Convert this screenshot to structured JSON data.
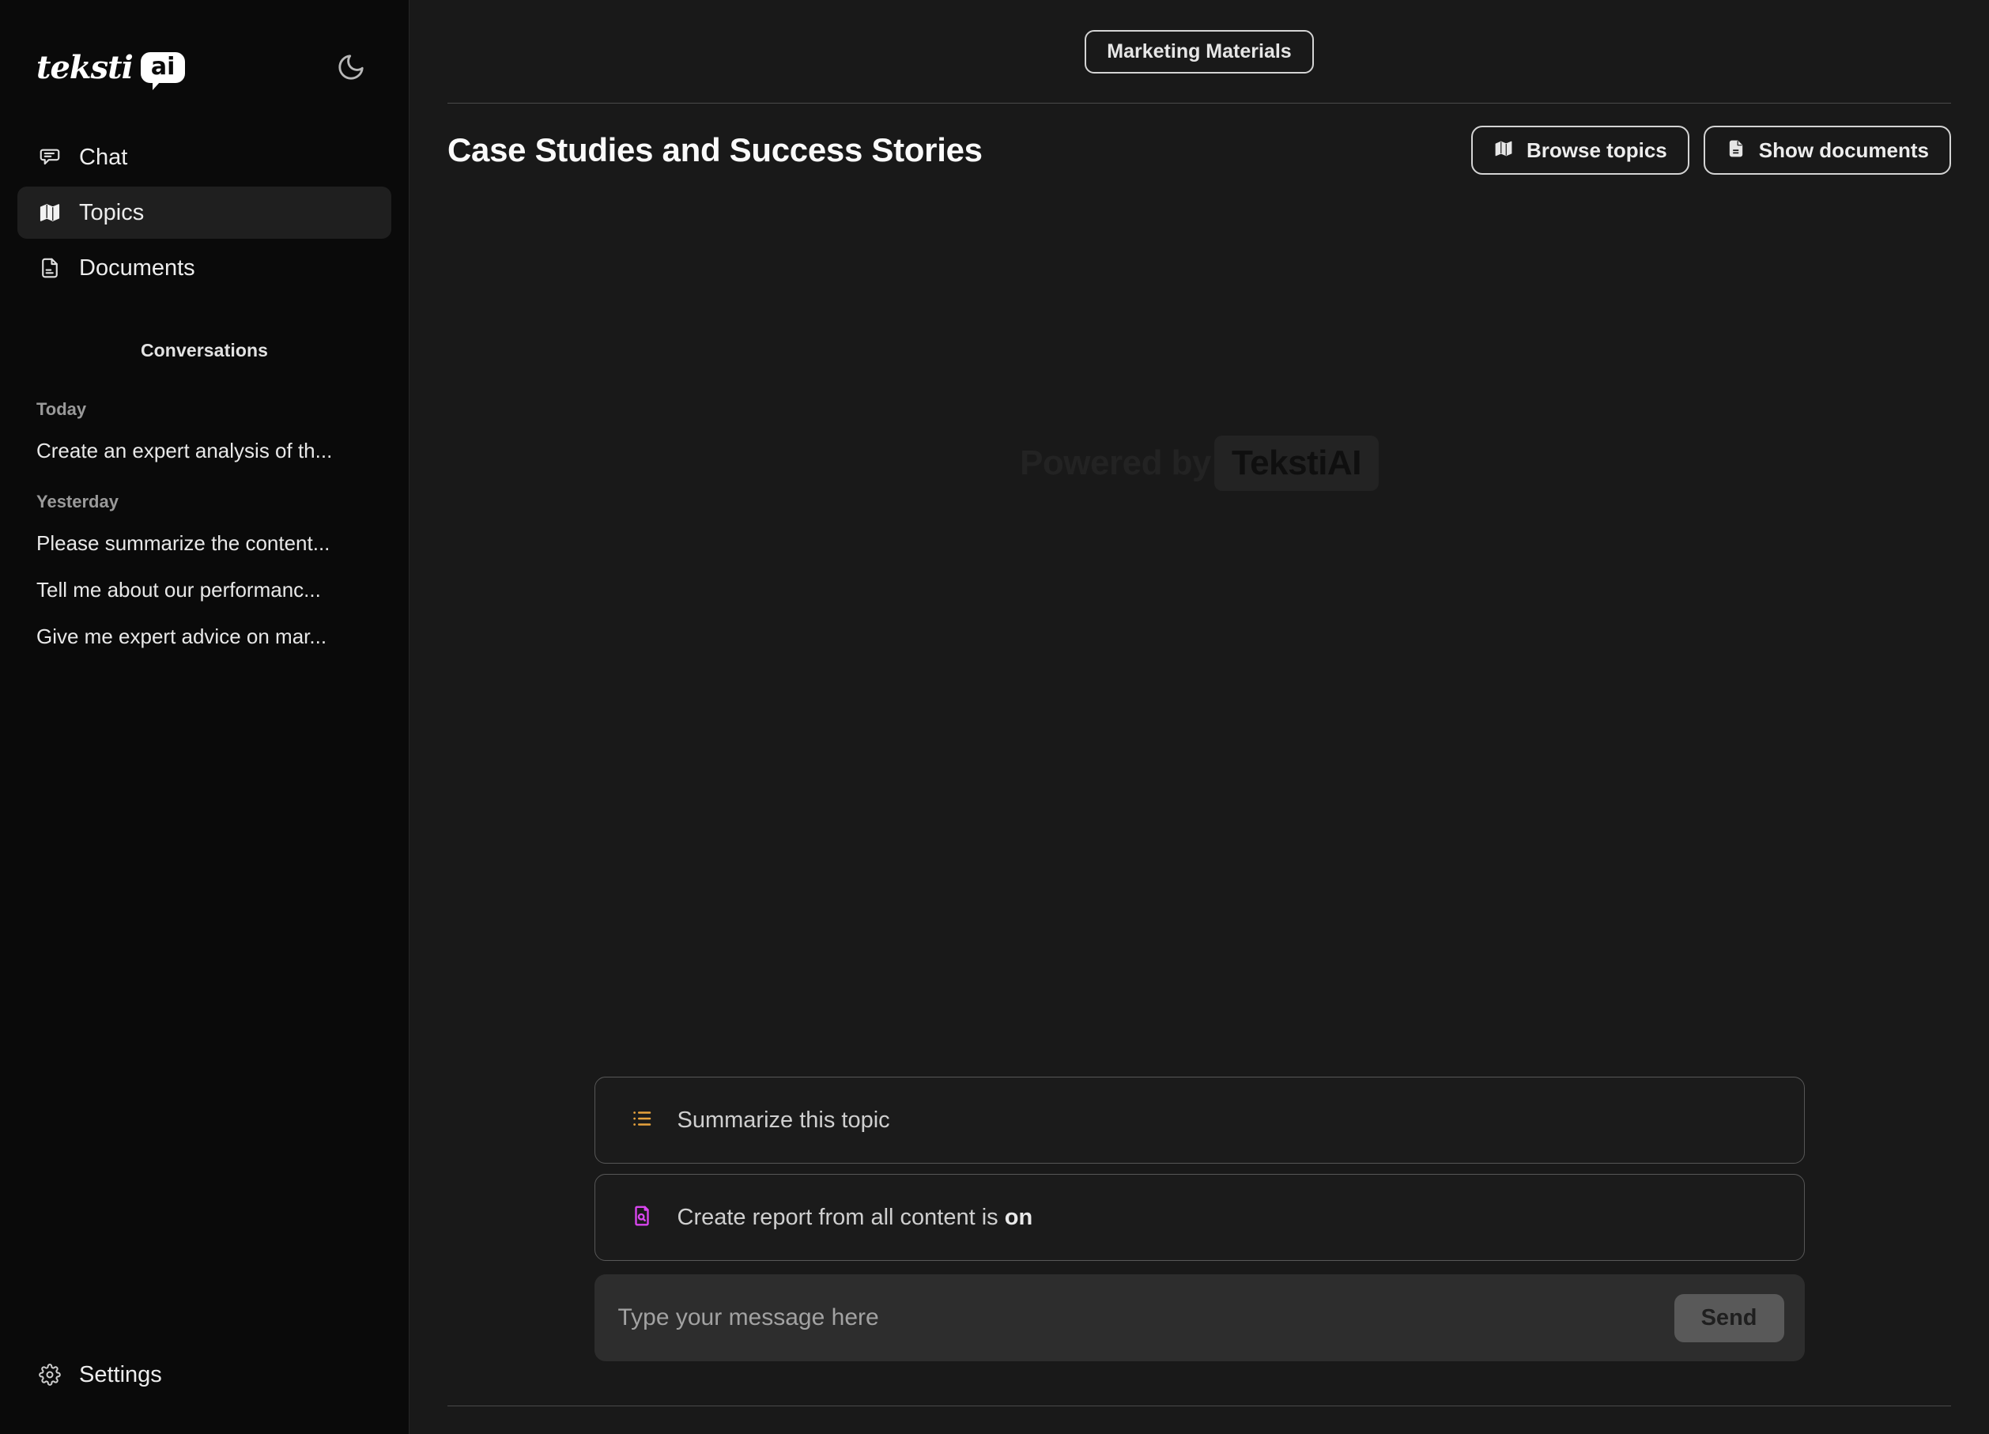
{
  "sidebar": {
    "logo": {
      "word": "teksti",
      "badge": "ai"
    },
    "theme_toggle_icon": "moon-icon",
    "nav": [
      {
        "label": "Chat",
        "icon": "chat-bubble-icon",
        "active": false
      },
      {
        "label": "Topics",
        "icon": "map-icon",
        "active": true
      },
      {
        "label": "Documents",
        "icon": "document-icon",
        "active": false
      }
    ],
    "conversations_title": "Conversations",
    "groups": [
      {
        "label": "Today",
        "items": [
          "Create an expert analysis of th..."
        ]
      },
      {
        "label": "Yesterday",
        "items": [
          "Please summarize the content...",
          "Tell me about our performanc...",
          "Give me expert advice on mar..."
        ]
      }
    ],
    "settings": {
      "label": "Settings",
      "icon": "gear-icon"
    }
  },
  "main": {
    "breadcrumb_chip": "Marketing Materials",
    "page_title": "Case Studies and Success Stories",
    "actions": [
      {
        "label": "Browse topics",
        "icon": "map-icon"
      },
      {
        "label": "Show documents",
        "icon": "document-icon"
      }
    ],
    "watermark": {
      "prefix": "Powered by",
      "brand": "TekstiAI"
    },
    "suggestions": [
      {
        "icon": "list-icon",
        "icon_color": "#e8a33d",
        "text_before": "Summarize this topic",
        "text_bold": "",
        "text_after": ""
      },
      {
        "icon": "file-search-icon",
        "icon_color": "#d946ef",
        "text_before": "Create report from all content is ",
        "text_bold": "on",
        "text_after": ""
      }
    ],
    "composer": {
      "placeholder": "Type your message here",
      "value": "",
      "send_label": "Send"
    }
  },
  "colors": {
    "sidebar_bg": "#0a0a0a",
    "main_bg": "#191919",
    "active_item_bg": "#1f1f1f",
    "accent_orange": "#e8a33d",
    "accent_magenta": "#d946ef",
    "send_btn_bg": "#595959"
  }
}
